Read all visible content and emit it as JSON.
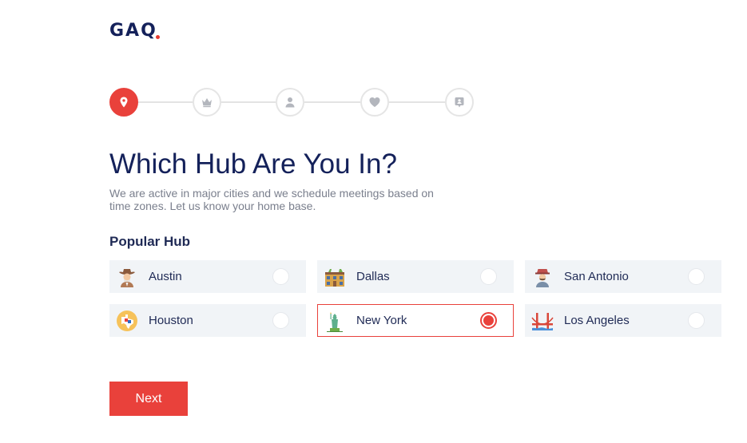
{
  "brand": {
    "logo_text": "GAQ",
    "accent_color": "#e9413b",
    "primary_color": "#14215a"
  },
  "stepper": {
    "steps": [
      {
        "icon": "location-pin-icon",
        "active": true
      },
      {
        "icon": "crown-icon",
        "active": false
      },
      {
        "icon": "person-icon",
        "active": false
      },
      {
        "icon": "heart-icon",
        "active": false
      },
      {
        "icon": "contact-card-icon",
        "active": false
      }
    ]
  },
  "page": {
    "title": "Which Hub Are You In?",
    "subtitle": "We are active in major cities and we schedule meetings based on time zones. Let us know your home base.",
    "section_title": "Popular Hub"
  },
  "hubs": [
    {
      "name": "Austin",
      "icon": "cowboy-icon",
      "selected": false
    },
    {
      "name": "Dallas",
      "icon": "building-icon",
      "selected": false
    },
    {
      "name": "San Antonio",
      "icon": "man-hat-icon",
      "selected": false
    },
    {
      "name": "Houston",
      "icon": "texas-map-icon",
      "selected": false
    },
    {
      "name": "New York",
      "icon": "statue-of-liberty-icon",
      "selected": true
    },
    {
      "name": "Los Angeles",
      "icon": "golden-gate-bridge-icon",
      "selected": false
    }
  ],
  "actions": {
    "next_label": "Next"
  }
}
